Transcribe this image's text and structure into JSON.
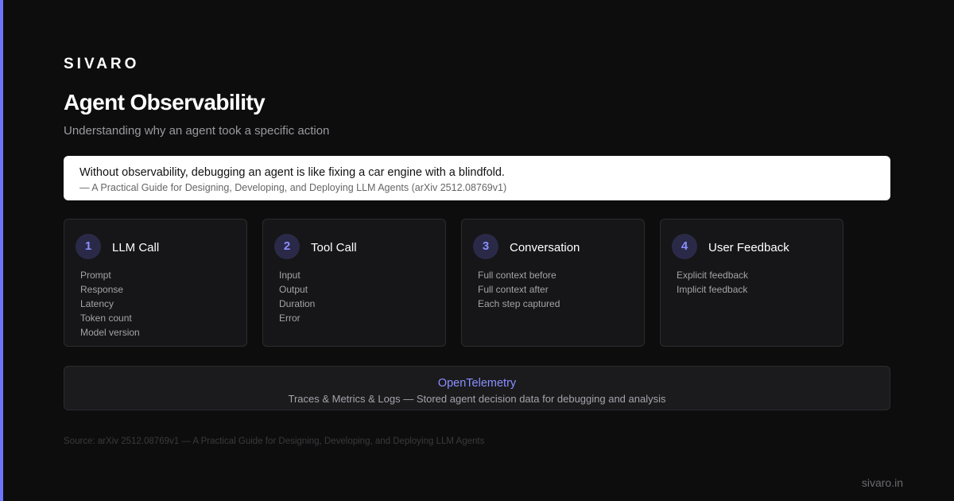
{
  "brand": "SIVARO",
  "title": "Agent Observability",
  "subtitle": "Understanding why an agent took a specific action",
  "quote": {
    "text": "Without observability, debugging an agent is like fixing a car engine with a blindfold.",
    "source": "— A Practical Guide for Designing, Developing, and Deploying LLM Agents (arXiv 2512.08769v1)"
  },
  "cards": [
    {
      "number": "1",
      "title": "LLM Call",
      "items": [
        "Prompt",
        "Response",
        "Latency",
        "Token count",
        "Model version"
      ]
    },
    {
      "number": "2",
      "title": "Tool Call",
      "items": [
        "Input",
        "Output",
        "Duration",
        "Error"
      ]
    },
    {
      "number": "3",
      "title": "Conversation",
      "items": [
        "Full context before",
        "Full context after",
        "Each step captured"
      ]
    },
    {
      "number": "4",
      "title": "User Feedback",
      "items": [
        "Explicit feedback",
        "Implicit feedback"
      ]
    }
  ],
  "otel": {
    "title": "OpenTelemetry",
    "description": "Traces & Metrics & Logs — Stored agent decision data for debugging and analysis"
  },
  "source": "Source: arXiv 2512.08769v1 — A Practical Guide for Designing, Developing, and Deploying LLM Agents",
  "site": "sivaro.in",
  "colors": {
    "accent": "#6f74ff",
    "background": "#0d0d0d",
    "card": "#161618",
    "number_badge": "#2a2a48"
  }
}
